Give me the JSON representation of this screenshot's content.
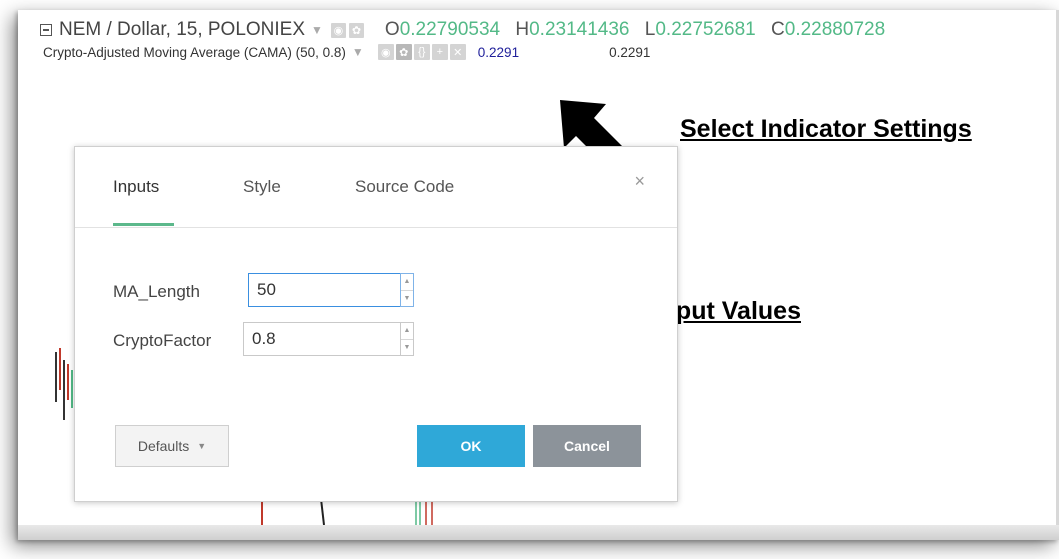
{
  "legend": {
    "symbol": "NEM / Dollar, 15, POLONIEX",
    "ohlc": [
      {
        "k": "O",
        "v": "0.22790534"
      },
      {
        "k": "H",
        "v": "0.23141436"
      },
      {
        "k": "L",
        "v": "0.22752681"
      },
      {
        "k": "C",
        "v": "0.22880728"
      }
    ],
    "indicator": "Crypto-Adjusted Moving Average (CAMA) (50, 0.8)",
    "indicator_value": "0.2291",
    "indicator_value2": "0.2291"
  },
  "callouts": {
    "settings": "Select Indicator Settings",
    "inputs": "Adjust Input Values"
  },
  "dialog": {
    "tabs": [
      "Inputs",
      "Style",
      "Source Code"
    ],
    "active_tab": "Inputs",
    "close": "×",
    "fields": [
      {
        "label": "MA_Length",
        "value": "50"
      },
      {
        "label": "CryptoFactor",
        "value": "0.8"
      }
    ],
    "defaults_label": "Defaults",
    "ok_label": "OK",
    "cancel_label": "Cancel"
  },
  "colors": {
    "accent_green": "#53b987",
    "ok_blue": "#2fa8d8",
    "cancel_gray": "#8c939a",
    "focus_blue": "#3a8fe0"
  }
}
